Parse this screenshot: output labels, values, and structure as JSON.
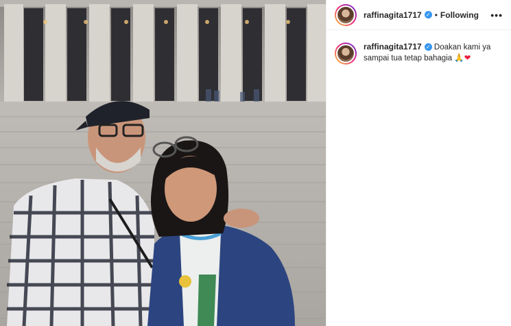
{
  "post": {
    "author": {
      "username": "raffinagita1717",
      "verified_icon": "verified-badge-icon",
      "follow_state": "Following",
      "separator": "•"
    },
    "more_label": "•••",
    "caption": {
      "username": "raffinagita1717",
      "text": "Doakan kami ya sampai tua tetap bahagia",
      "emoji_pray": "🙏",
      "emoji_heart": "❤"
    }
  },
  "colors": {
    "verified": "#3897f0",
    "text": "#262626",
    "divider": "#efefef"
  }
}
